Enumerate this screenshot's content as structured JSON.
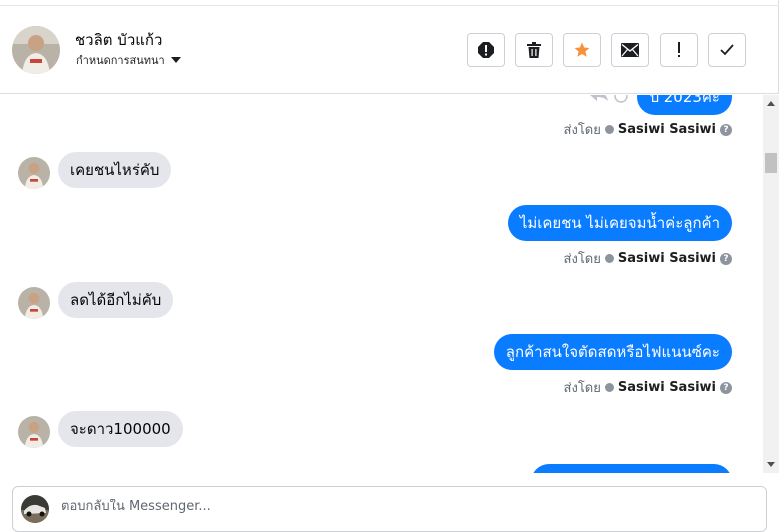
{
  "header": {
    "contact_name": "ชวลิต บัวแก้ว",
    "label_dropdown": "กำหนดการสนทนา",
    "actions": [
      {
        "name": "spam-button",
        "icon": "alert-circle-icon",
        "glyph": "!"
      },
      {
        "name": "delete-button",
        "icon": "trash-icon",
        "glyph": ""
      },
      {
        "name": "star-button",
        "icon": "star-icon",
        "glyph": ""
      },
      {
        "name": "mark-unread-button",
        "icon": "envelope-icon",
        "glyph": ""
      },
      {
        "name": "follow-up-button",
        "icon": "exclamation-icon",
        "glyph": "!"
      },
      {
        "name": "mark-done-button",
        "icon": "check-icon",
        "glyph": ""
      }
    ]
  },
  "colors": {
    "outgoing_bubble": "#0a7cff",
    "incoming_bubble": "#e4e6eb",
    "star": "#f7923b"
  },
  "messages": [
    {
      "direction": "out",
      "text": "ป 2023ค่ะ",
      "sent_by_prefix": "ส่งโดย",
      "sent_by_name": "Sasiwi Sasiwi",
      "partial": true
    },
    {
      "direction": "in",
      "text": "เคยชนไหร่คับ"
    },
    {
      "direction": "out",
      "text": "ไม่เคยชน ไม่เคยจมน้ำค่ะลูกค้า",
      "sent_by_prefix": "ส่งโดย",
      "sent_by_name": "Sasiwi Sasiwi"
    },
    {
      "direction": "in",
      "text": "ลดได้อีกไม่คับ"
    },
    {
      "direction": "out",
      "text": "ลูกค้าสนใจตัดสดหรือไฟแนนซ์คะ",
      "sent_by_prefix": "ส่งโดย",
      "sent_by_name": "Sasiwi Sasiwi"
    },
    {
      "direction": "in",
      "text": "จะดาว100000"
    }
  ],
  "composer": {
    "placeholder": "ตอบกลับใน Messenger..."
  }
}
